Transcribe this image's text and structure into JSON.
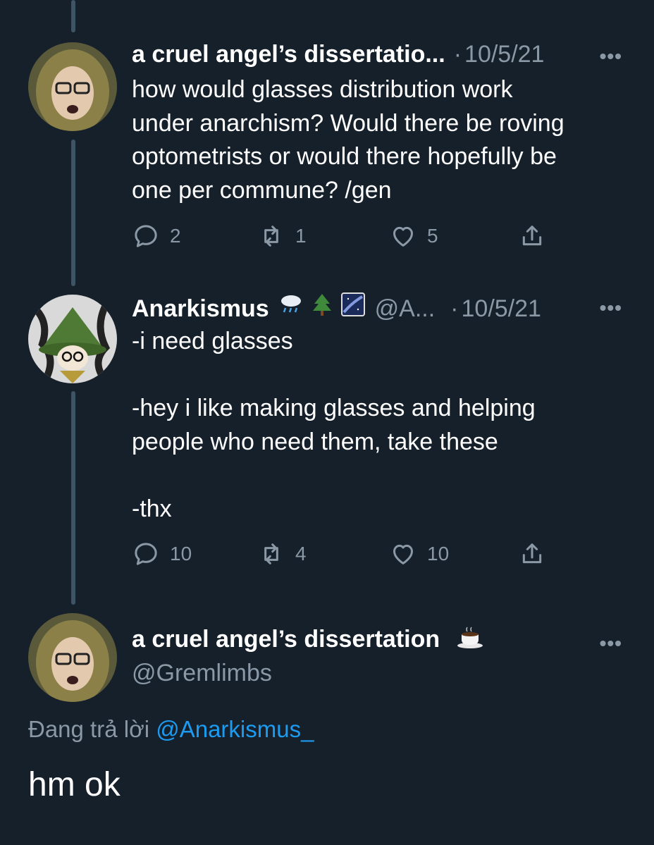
{
  "thread": [
    {
      "name": "a cruel angel’s dissertatio...",
      "handle": "",
      "date": "10/5/21",
      "more_label": "•••",
      "text": "how would glasses distribution work\nunder anarchism? Would there be roving\noptometrists or would there hopefully be\none per commune? /gen",
      "replies": "2",
      "retweets": "1",
      "likes": "5"
    },
    {
      "name": "Anarkismus",
      "name_emojis": [
        "cloud-rain-icon",
        "evergreen-tree-icon",
        "milky-way-icon"
      ],
      "handle": "@A...",
      "date": "10/5/21",
      "more_label": "•••",
      "text": "-i need glasses\n\n-hey i like making glasses and helping\npeople who need them, take these\n\n-thx",
      "replies": "10",
      "retweets": "4",
      "likes": "10"
    }
  ],
  "main_tweet": {
    "name": "a cruel angel’s dissertation",
    "name_emoji": "hot-beverage-icon",
    "handle": "@Gremlimbs",
    "more_label": "•••",
    "replying_prefix": "Đang trả lời",
    "replying_to": "@Anarkismus_",
    "text": "hm ok"
  },
  "colors": {
    "background": "#15202b",
    "secondary_text": "#8b98a5",
    "link": "#1d9bf0",
    "thread_line": "#3d5466"
  }
}
